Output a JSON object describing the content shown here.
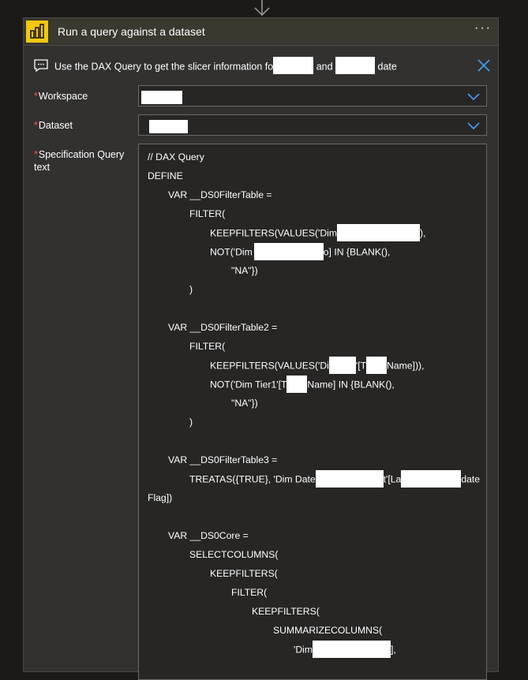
{
  "card": {
    "title": "Run a query against a dataset",
    "more_label": "···",
    "comment": {
      "prefix": "Use the DAX Query to get the slicer information fo",
      "middle": "and",
      "suffix": "date"
    }
  },
  "fields": {
    "workspace": {
      "label": "Workspace",
      "required": "*"
    },
    "dataset": {
      "label": "Dataset",
      "required": "*"
    },
    "query": {
      "label": "Specification Query text",
      "required": "*"
    }
  },
  "query_lines": [
    "// DAX Query",
    "DEFINE",
    "VAR __DS0FilterTable =",
    "FILTER(",
    "KEEPFILTERS(VALUES('Dim",
    "),",
    "NOT('Dim",
    "o] IN {BLANK(),",
    "\"NA\"})",
    ")",
    "VAR __DS0FilterTable2 =",
    "FILTER(",
    "KEEPFILTERS(VALUES('Di",
    "'[T",
    "Name])),",
    "NOT('Dim Tier1'[T",
    "Name] IN {BLANK(),",
    "\"NA\"})",
    ")",
    "VAR __DS0FilterTable3 =",
    "TREATAS({TRUE}, 'Dim Date",
    "t'[La",
    "date",
    "Flag])",
    "VAR __DS0Core =",
    "SELECTCOLUMNS(",
    "KEEPFILTERS(",
    "FILTER(",
    "KEEPFILTERS(",
    "SUMMARIZECOLUMNS(",
    "'Dim",
    "],"
  ]
}
